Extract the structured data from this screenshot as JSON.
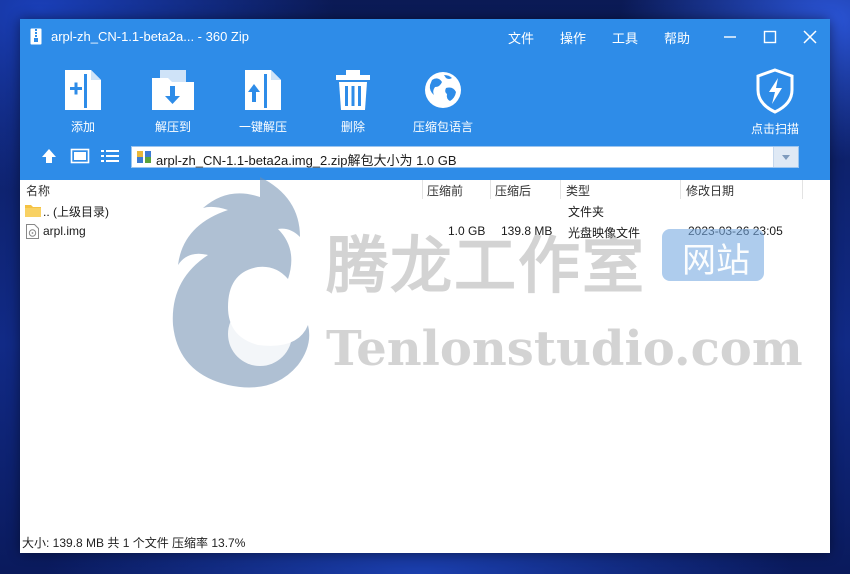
{
  "window": {
    "title": "arpl-zh_CN-1.1-beta2a... - 360 Zip",
    "menu": [
      "文件",
      "操作",
      "工具",
      "帮助"
    ]
  },
  "toolbar": {
    "add": "添加",
    "extract_to": "解压到",
    "one_click_extract": "一键解压",
    "delete": "删除",
    "package_language": "压缩包语言",
    "scan": "点击扫描"
  },
  "path": {
    "text": "arpl-zh_CN-1.1-beta2a.img_2.zip解包大小为 1.0 GB"
  },
  "columns": {
    "name": "名称",
    "compressed_before": "压缩前",
    "compressed_after": "压缩后",
    "type": "类型",
    "modified": "修改日期"
  },
  "files": [
    {
      "name": ".. (上级目录)",
      "before": "",
      "after": "",
      "type": "文件夹",
      "modified": ""
    },
    {
      "name": "arpl.img",
      "before": "1.0 GB",
      "after": "139.8 MB",
      "type": "光盘映像文件",
      "modified": "2023-03-26 23:05"
    }
  ],
  "status": {
    "text": "大小: 139.8 MB 共 1 个文件 压缩率 13.7%"
  },
  "watermark": {
    "cn": "腾龙工作室",
    "badge": "网站",
    "en": "Tenlonstudio.com"
  },
  "colors": {
    "accent": "#2e8ce8",
    "folder": "#f5c242"
  }
}
